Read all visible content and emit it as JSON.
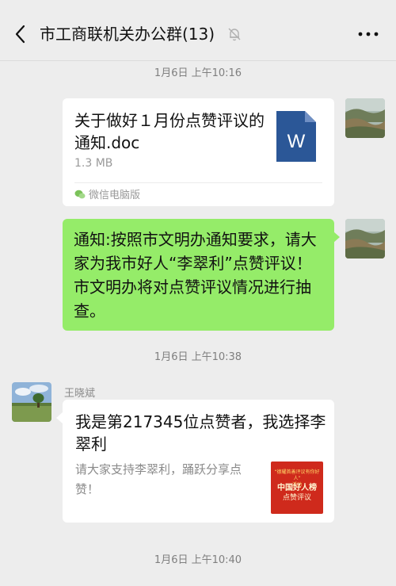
{
  "header": {
    "title": "市工商联机关办公群(13)",
    "back_icon": "chevron-left-icon",
    "mute_icon": "bell-off-icon",
    "more_icon": "more-dots-icon"
  },
  "timestamps": [
    "1月6日 上午10:16",
    "1月6日 上午10:38",
    "1月6日 上午10:40"
  ],
  "messages": {
    "file": {
      "name": "关于做好１月份点赞评议的通知.doc",
      "size": "1.3 MB",
      "source": "微信电脑版",
      "icon_letter": "W",
      "icon_color": "#2b5797"
    },
    "notice": {
      "text": "通知:按照市文明办通知要求，请大家为我市好人“李翠利”点赞评议！市文明办将对点赞评议情况进行抽查。",
      "bubble_color": "#95ec69"
    },
    "share": {
      "sender": "王晓斌",
      "title": "我是第217345位点赞者，我选择李翠利",
      "description": "请大家支持李翠利，踊跃分享点赞！",
      "thumb_line1": "“德耀首善评议有你好人”",
      "thumb_line1b": "活动",
      "thumb_line2": "中国好人榜",
      "thumb_line3": "点赞评议",
      "thumb_color": "#cf2a1c"
    }
  }
}
